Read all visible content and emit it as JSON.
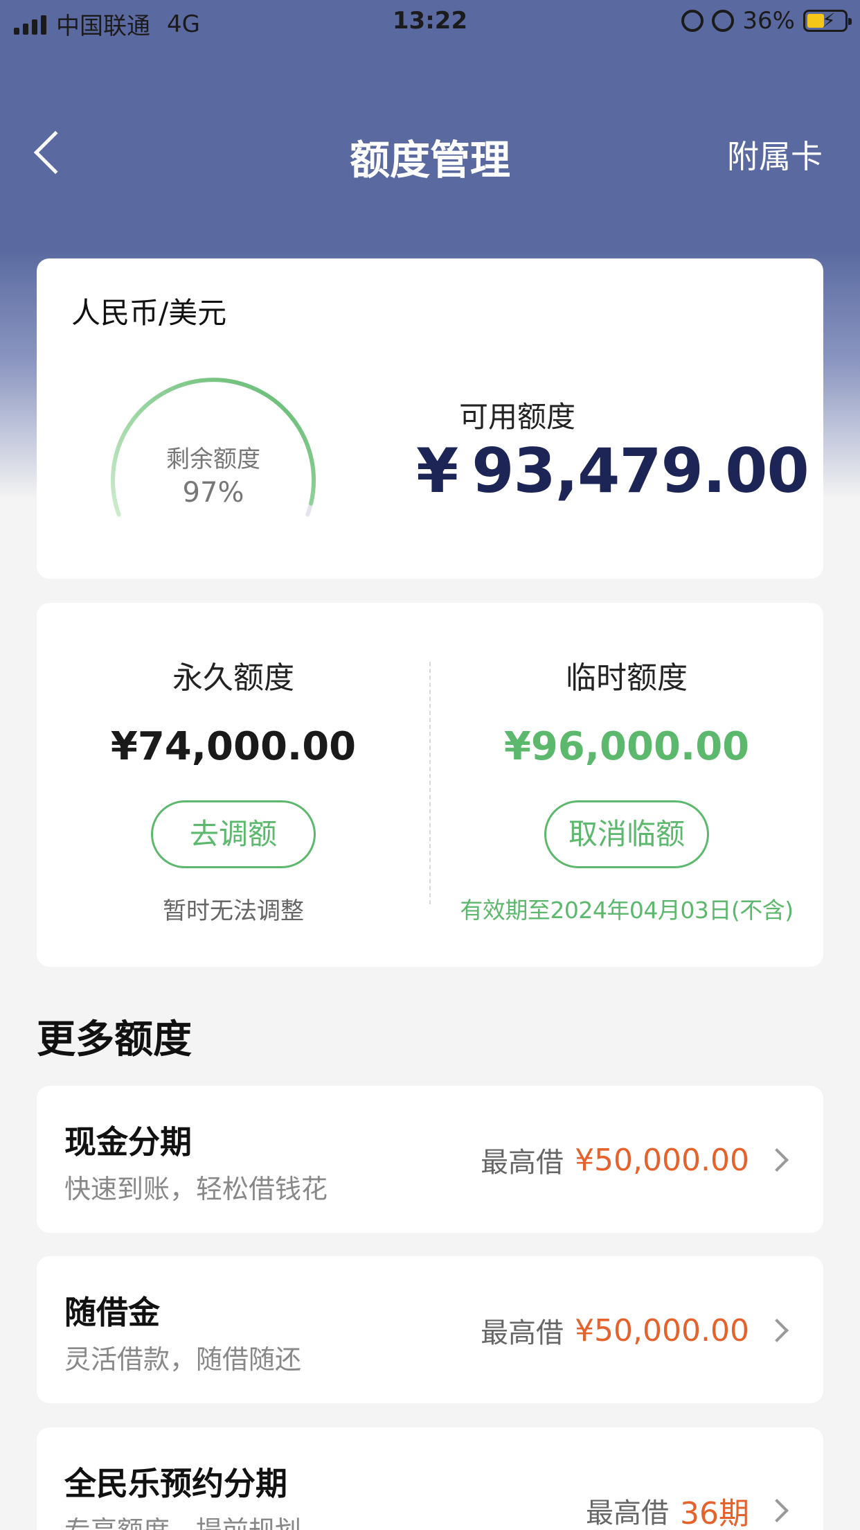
{
  "status_bar": {
    "carrier": "中国联通",
    "network": "4G",
    "time": "13:22",
    "battery": "36%",
    "icons": [
      "signal-icon",
      "rotation-lock-icon",
      "alarm-icon",
      "battery-charging-icon"
    ]
  },
  "nav": {
    "back_icon": "chevron-left-icon",
    "title": "额度管理",
    "right_link": "附属卡"
  },
  "summary": {
    "currency_label": "人民币/美元",
    "gauge_label": "剩余额度",
    "gauge_percent": "97%",
    "gauge_fraction": 0.97,
    "available_label": "可用额度",
    "currency_symbol": "¥",
    "available_amount": "93,479.00"
  },
  "limits": {
    "permanent": {
      "title": "永久额度",
      "amount": "¥74,000.00",
      "button": "去调额",
      "note": "暂时无法调整"
    },
    "temporary": {
      "title": "临时额度",
      "amount": "¥96,000.00",
      "button": "取消临额",
      "note": "有效期至2024年04月03日(不含)"
    }
  },
  "more": {
    "title": "更多额度",
    "items": [
      {
        "title": "现金分期",
        "subtitle": "快速到账，轻松借钱花",
        "prefix": "最高借",
        "amount": "¥50,000.00"
      },
      {
        "title": "随借金",
        "subtitle": "灵活借款，随借随还",
        "prefix": "最高借",
        "amount": "¥50,000.00"
      },
      {
        "title": "全民乐预约分期",
        "subtitle": "专享额度，提前规划",
        "prefix": "最高借",
        "amount": "36期"
      }
    ]
  },
  "colors": {
    "header_bg": "#5a6aa0",
    "accent_green": "#5cb86c",
    "amount_orange": "#e5622c",
    "amount_navy": "#1d2556"
  }
}
